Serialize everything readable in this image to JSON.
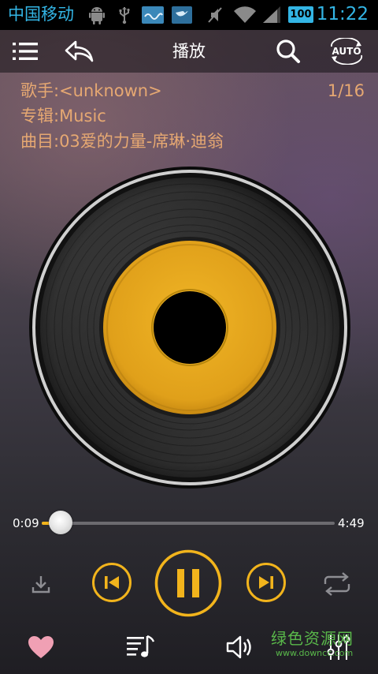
{
  "status_bar": {
    "carrier": "中国移动",
    "battery": "100",
    "time": "11:22"
  },
  "toolbar": {
    "title": "播放",
    "auto_label": "AUTO"
  },
  "song": {
    "artist": "歌手:<unknown>",
    "album": "专辑:Music",
    "title": "曲目:03爱的力量-席琳·迪翁",
    "track_index": "1/16"
  },
  "progress": {
    "elapsed": "0:09",
    "total": "4:49",
    "fraction": 0.031
  },
  "playback": {
    "state": "playing"
  },
  "watermark": {
    "main": "绿色资源网",
    "sub": "www.downcc.com"
  },
  "colors": {
    "accent": "#f2b41c",
    "info_text": "#e6a872",
    "favorite": "#f0a0b4",
    "record_label": "#e8a81c"
  },
  "icons": {
    "menu": "menu-icon",
    "back": "back-icon",
    "search": "search-icon",
    "auto": "auto-rotate-icon",
    "download": "download-icon",
    "previous": "previous-icon",
    "pause": "pause-icon",
    "next": "next-icon",
    "repeat": "repeat-icon",
    "favorite": "heart-icon",
    "playlist": "playlist-icon",
    "volume": "volume-icon",
    "equalizer": "equalizer-icon"
  }
}
